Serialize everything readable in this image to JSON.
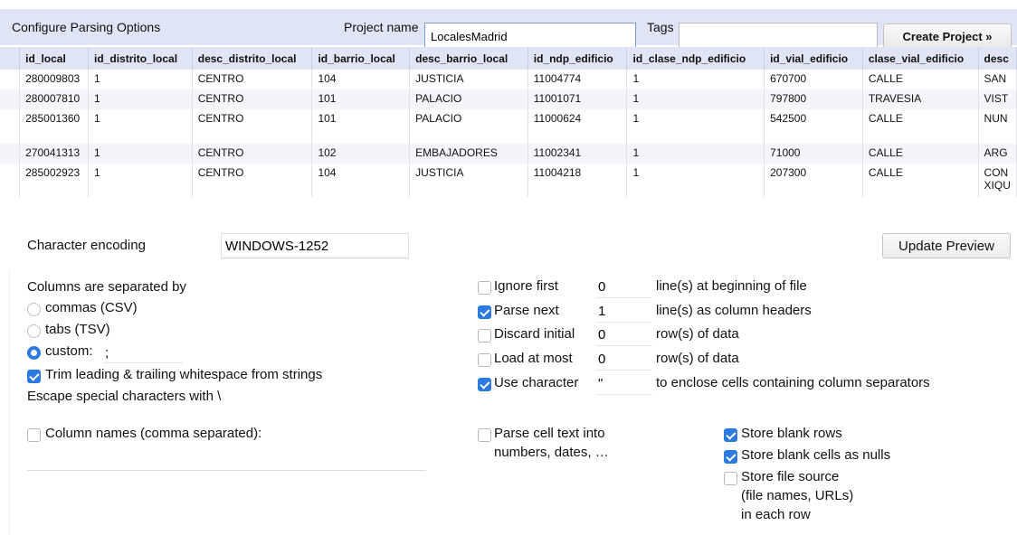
{
  "header": {
    "title": "Configure Parsing Options",
    "project_name_label": "Project name",
    "project_name_value": "LocalesMadrid",
    "tags_label": "Tags",
    "tags_value": "",
    "create_button": "Create Project »"
  },
  "preview": {
    "columns": [
      "",
      "id_local",
      "id_distrito_local",
      "desc_distrito_local",
      "id_barrio_local",
      "desc_barrio_local",
      "id_ndp_edificio",
      "id_clase_ndp_edificio",
      "id_vial_edificio",
      "clase_vial_edificio",
      "desc"
    ],
    "rows": [
      [
        "",
        "280009803",
        "1",
        "CENTRO",
        "104",
        "JUSTICIA",
        "11004774",
        "1",
        "670700",
        "CALLE",
        "SAN"
      ],
      [
        "",
        "280007810",
        "1",
        "CENTRO",
        "101",
        "PALACIO",
        "11001071",
        "1",
        "797800",
        "TRAVESIA",
        "VIST"
      ],
      [
        "",
        "285001360",
        "1",
        "CENTRO",
        "101",
        "PALACIO",
        "11000624",
        "1",
        "542500",
        "CALLE",
        "NUN"
      ],
      [
        "",
        "270041313",
        "1",
        "CENTRO",
        "102",
        "EMBAJADORES",
        "11002341",
        "1",
        "71000",
        "CALLE",
        "ARG"
      ],
      [
        "",
        "285002923",
        "1",
        "CENTRO",
        "104",
        "JUSTICIA",
        "11004218",
        "1",
        "207300",
        "CALLE",
        "CON\nXIQU"
      ]
    ]
  },
  "options": {
    "encoding_label": "Character encoding",
    "encoding_value": "WINDOWS-1252",
    "update_button": "Update Preview",
    "separator_label": "Columns are separated by",
    "sep_commas": "commas (CSV)",
    "sep_tabs": "tabs (TSV)",
    "sep_custom": "custom:",
    "sep_custom_value": ";",
    "trim_label": "Trim leading & trailing whitespace from strings",
    "escape_label": "Escape special characters with \\",
    "column_names_label": "Column names (comma separated):",
    "ignore_first_label": "Ignore first",
    "ignore_first_value": "0",
    "ignore_first_suffix": "line(s) at beginning of file",
    "parse_next_label": "Parse next",
    "parse_next_value": "1",
    "parse_next_suffix": "line(s) as column headers",
    "discard_initial_label": "Discard initial",
    "discard_initial_value": "0",
    "discard_initial_suffix": "row(s) of data",
    "load_at_most_label": "Load at most",
    "load_at_most_value": "0",
    "load_at_most_suffix": "row(s) of data",
    "use_character_label": "Use character",
    "use_character_value": "\"",
    "use_character_suffix": "to enclose cells containing column separators",
    "parse_cell_line1": "Parse cell text into",
    "parse_cell_line2": "numbers, dates, …",
    "store_blank_rows": "Store blank rows",
    "store_blank_cells": "Store blank cells as nulls",
    "store_source_line1": "Store file source",
    "store_source_line2": "(file names, URLs)",
    "store_source_line3": "in each row"
  }
}
